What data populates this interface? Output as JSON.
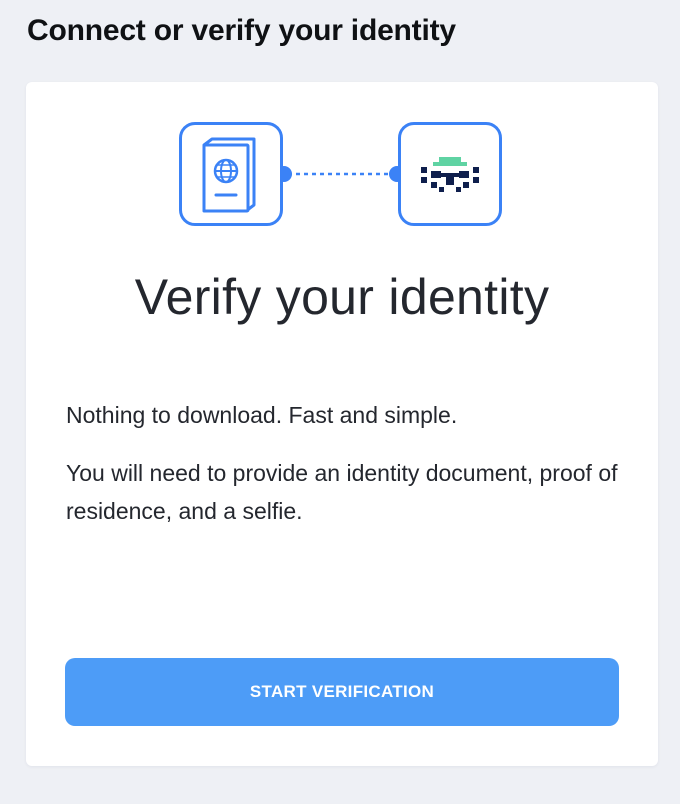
{
  "page": {
    "heading": "Connect or verify your identity"
  },
  "card": {
    "illustration": {
      "left_icon": "passport-icon",
      "right_icon": "face-scan-icon",
      "connector": "dotted-line"
    },
    "title": "Verify your identity",
    "intro": "Nothing to download. Fast and simple.",
    "requirements": "You will need to provide an identity document, proof of residence, and a selfie.",
    "button_label": "START VERIFICATION"
  },
  "colors": {
    "accent": "#3b82f6",
    "button": "#4d9cf7",
    "face_dark": "#0f1f4d",
    "face_accent": "#5fd3a3",
    "background": "#eef0f5"
  }
}
